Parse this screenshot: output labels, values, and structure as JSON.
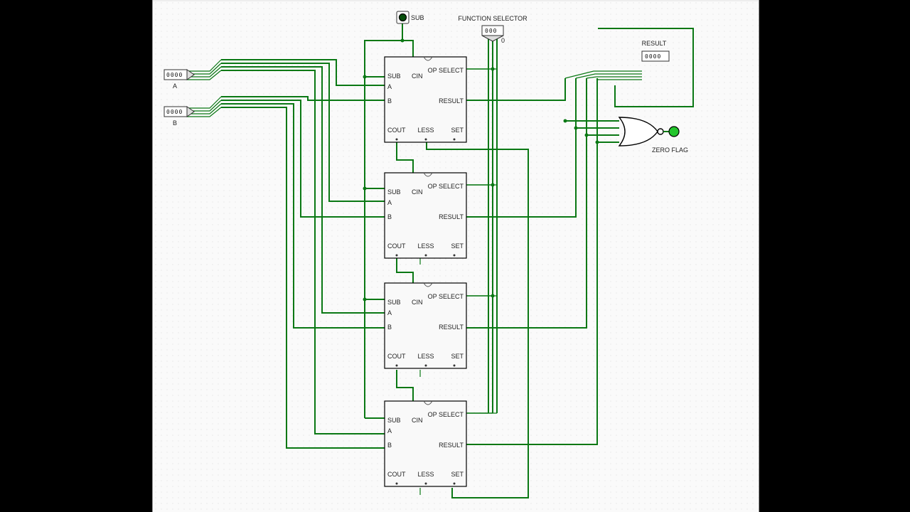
{
  "inputs": {
    "sub": {
      "label": "SUB",
      "value": 0
    },
    "function_selector": {
      "label": "FUNCTION SELECTOR",
      "value": "000",
      "tri_out": "0"
    },
    "a": {
      "label": "A",
      "value": "0000"
    },
    "b": {
      "label": "B",
      "value": "0000"
    }
  },
  "outputs": {
    "result": {
      "label": "RESULT",
      "value": "0000"
    },
    "zero_flag": {
      "label": "ZERO FLAG",
      "value": 0
    }
  },
  "slice_labels": {
    "sub": "SUB",
    "cin": "CIN",
    "op_select": "OP SELECT",
    "a": "A",
    "b": "B",
    "result": "RESULT",
    "cout": "COUT",
    "less": "LESS",
    "set": "SET"
  },
  "slice_count": 4,
  "colors": {
    "wire": "#0a7814",
    "canvas": "#fafafa"
  }
}
